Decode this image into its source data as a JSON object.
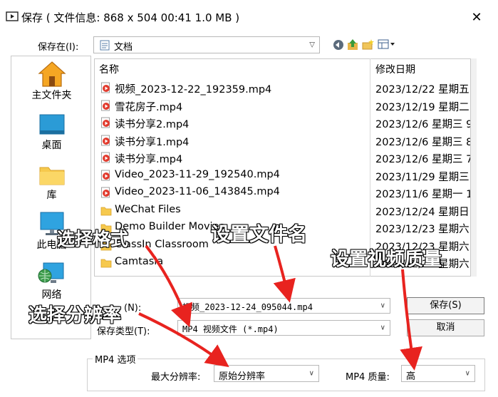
{
  "window": {
    "title": "保存 ( 文件信息: 868 x 504    00:41    1.0 MB )",
    "close_glyph": "✕"
  },
  "save_in": {
    "label": "保存在(I):",
    "value": "文档"
  },
  "places": [
    {
      "label": "主文件夹",
      "icon": "home-icon"
    },
    {
      "label": "桌面",
      "icon": "desktop-icon"
    },
    {
      "label": "库",
      "icon": "library-folder-icon"
    },
    {
      "label": "此电脑",
      "icon": "computer-icon"
    },
    {
      "label": "网络",
      "icon": "network-icon"
    }
  ],
  "list": {
    "headers": [
      "名称",
      "修改日期"
    ],
    "files": [
      {
        "name": "视频_2023-12-22_192359.mp4",
        "date": "2023/12/22 星期五",
        "type": "video"
      },
      {
        "name": "雪花房子.mp4",
        "date": "2023/12/19 星期二",
        "type": "video"
      },
      {
        "name": "读书分享2.mp4",
        "date": "2023/12/6 星期三 9",
        "type": "video"
      },
      {
        "name": "读书分享1.mp4",
        "date": "2023/12/6 星期三 8",
        "type": "video"
      },
      {
        "name": "读书分享.mp4",
        "date": "2023/12/6 星期三 7",
        "type": "video"
      },
      {
        "name": "Video_2023-11-29_192540.mp4",
        "date": "2023/11/29 星期三",
        "type": "video"
      },
      {
        "name": "Video_2023-11-06_143845.mp4",
        "date": "2023/11/6 星期一 1",
        "type": "video"
      },
      {
        "name": "WeChat Files",
        "date": "2023/12/24 星期日",
        "type": "folder"
      },
      {
        "name": "Demo Builder Movies",
        "date": "2023/12/23 星期六",
        "type": "folder"
      },
      {
        "name": "ClassIn Classroom",
        "date": "2023/12/23 星期六",
        "type": "folder"
      },
      {
        "name": "Camtasia",
        "date": "2023/12/23 星期六",
        "type": "folder"
      }
    ]
  },
  "filename": {
    "label": "(N):",
    "value": "视频_2023-12-24_095044.mp4"
  },
  "filetype": {
    "label": "保存类型(T):",
    "value": "MP4 视频文件 (*.mp4)"
  },
  "buttons": {
    "save": "保存(S)",
    "cancel": "取消"
  },
  "options": {
    "group_label": "MP4 选项",
    "resolution_label": "最大分辨率:",
    "resolution_value": "原始分辨率",
    "quality_label": "MP4 质量:",
    "quality_value": "高"
  },
  "annotations": {
    "format": "选择格式",
    "filename": "设置文件名",
    "quality": "设置视频质量",
    "resolution": "选择分辨率",
    "color": "#e8231f"
  }
}
